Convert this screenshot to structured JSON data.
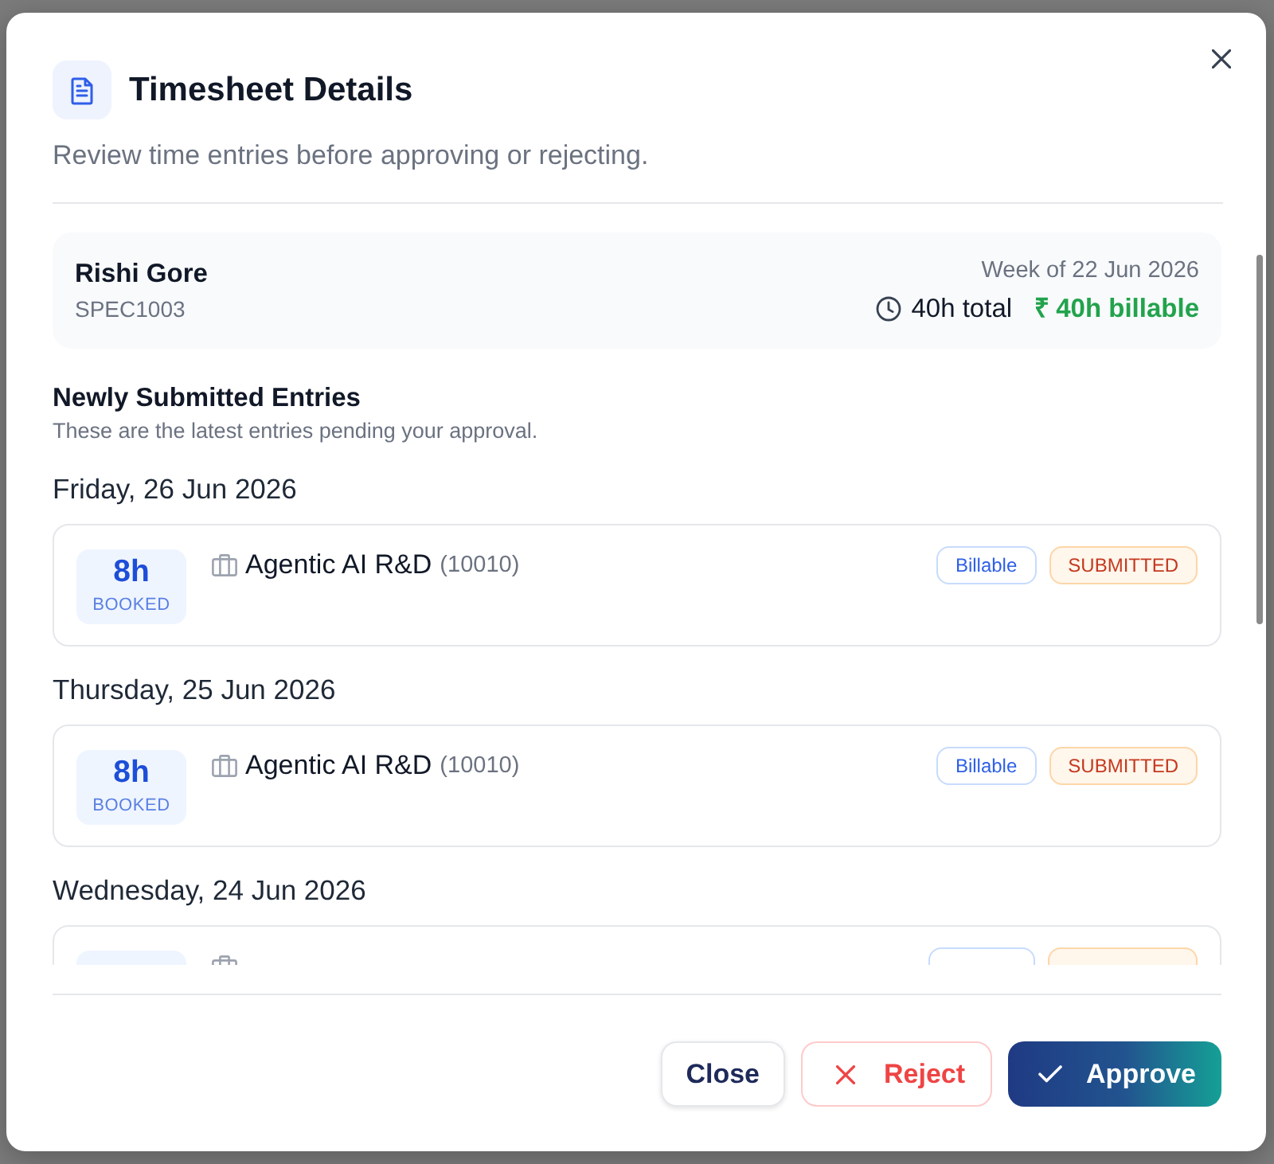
{
  "dialog": {
    "title": "Timesheet Details",
    "subtitle": "Review time entries before approving or rejecting."
  },
  "summary": {
    "name": "Rishi Gore",
    "employee_id": "SPEC1003",
    "week": "Week of 22 Jun 2026",
    "total": "40h total",
    "billable": "₹ 40h billable"
  },
  "section": {
    "title": "Newly Submitted Entries",
    "subtitle": "These are the latest entries pending your approval."
  },
  "days": [
    {
      "date": "Friday, 26 Jun 2026",
      "entries": [
        {
          "hours": "8h",
          "unit": "BOOKED",
          "project": "Agentic AI R&D",
          "code": "(10010)",
          "tags": [
            {
              "label": "Billable",
              "kind": "billing"
            },
            {
              "label": "SUBMITTED",
              "kind": "status"
            }
          ]
        }
      ]
    },
    {
      "date": "Thursday, 25 Jun 2026",
      "entries": [
        {
          "hours": "8h",
          "unit": "BOOKED",
          "project": "Agentic AI R&D",
          "code": "(10010)",
          "tags": [
            {
              "label": "Billable",
              "kind": "billing"
            },
            {
              "label": "SUBMITTED",
              "kind": "status"
            }
          ]
        }
      ]
    },
    {
      "date": "Wednesday, 24 Jun 2026",
      "entries": [
        {
          "tags": [
            {
              "kind": "billing"
            },
            {
              "kind": "status"
            }
          ]
        }
      ]
    }
  ],
  "buttons": [
    {
      "label": "Close",
      "kind": "secondary"
    },
    {
      "label": "Reject",
      "kind": "danger"
    },
    {
      "label": "Approve",
      "kind": "primary"
    }
  ]
}
